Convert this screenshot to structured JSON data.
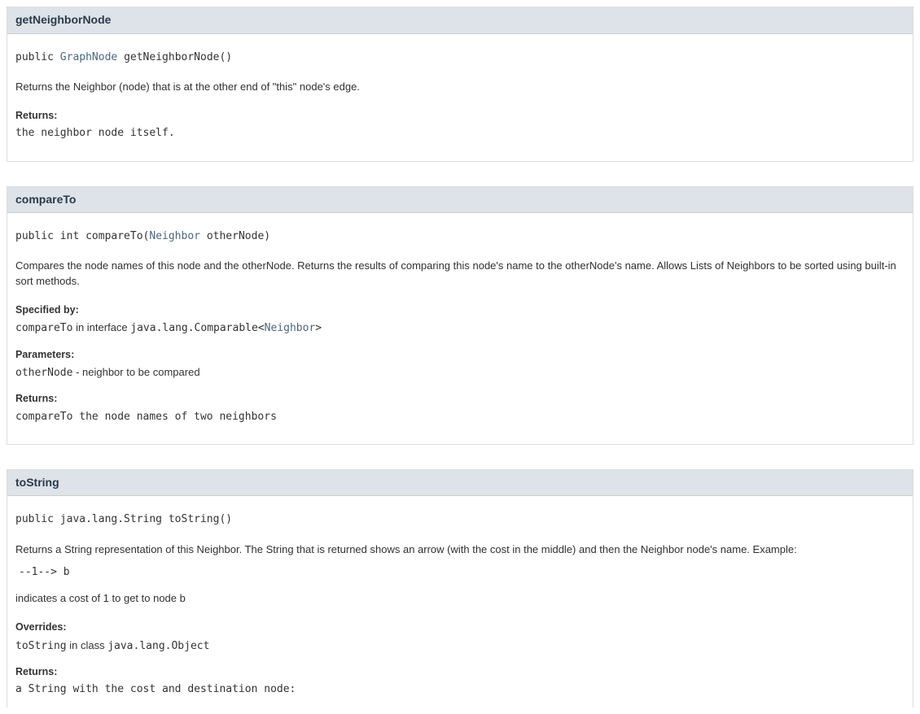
{
  "methods": [
    {
      "name": "getNeighborNode",
      "sig_prefix": "public ",
      "sig_link": "GraphNode",
      "sig_suffix": " getNeighborNode()",
      "desc": "Returns the Neighbor (node) that is at the other end of \"this\" node's edge.",
      "returns_label": "Returns:",
      "returns_text": "the neighbor node itself."
    },
    {
      "name": "compareTo",
      "sig_prefix": "public int compareTo(",
      "sig_link": "Neighbor",
      "sig_suffix": " otherNode)",
      "desc": "Compares the node names of this node and the otherNode. Returns the results of comparing this node's name to the otherNode's name. Allows Lists of Neighbors to be sorted using built-in sort methods.",
      "specified_label": "Specified by:",
      "specified_pre": "compareTo",
      "specified_mid": " in interface ",
      "specified_iface": "java.lang.Comparable<",
      "specified_link": "Neighbor",
      "specified_post": ">",
      "params_label": "Parameters:",
      "param_name": "otherNode",
      "param_desc": " - neighbor to be compared",
      "returns_label": "Returns:",
      "returns_text": "compareTo the node names of two neighbors"
    },
    {
      "name": "toString",
      "sig_full": "public java.lang.String toString()",
      "desc": "Returns a String representation of this Neighbor. The String that is returned shows an arrow (with the cost in the middle) and then the Neighbor node's name. Example:",
      "example": " --1--> b",
      "desc2": "indicates a cost of 1 to get to node b",
      "overrides_label": "Overrides:",
      "overrides_pre": "toString",
      "overrides_mid": " in class ",
      "overrides_class": "java.lang.Object",
      "returns_label": "Returns:",
      "returns_text": "a String with the cost and destination node:"
    }
  ]
}
